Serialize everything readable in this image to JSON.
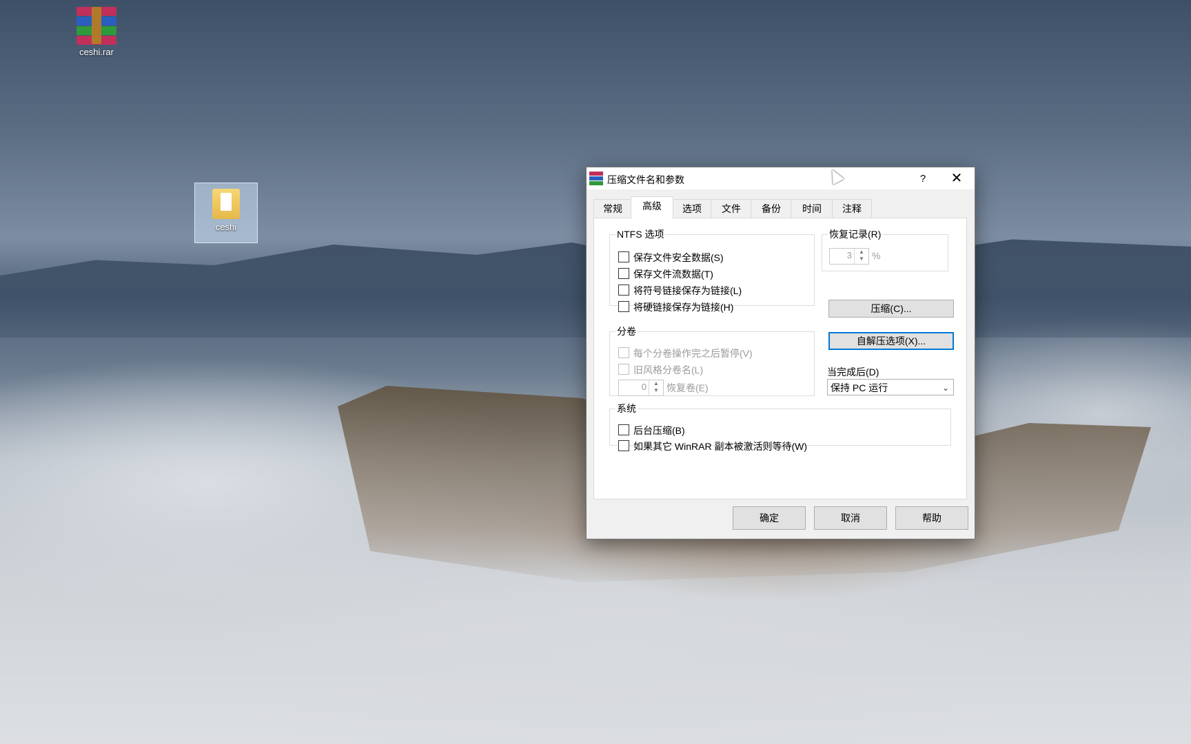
{
  "desktop": {
    "icons": [
      {
        "label": "ceshi.rar"
      },
      {
        "label": "ceshi"
      }
    ]
  },
  "dialog": {
    "title": "压缩文件名和参数",
    "help_glyph": "?",
    "close_glyph": "✕",
    "tabs": [
      {
        "label": "常规",
        "active": false
      },
      {
        "label": "高级",
        "active": true
      },
      {
        "label": "选项",
        "active": false
      },
      {
        "label": "文件",
        "active": false
      },
      {
        "label": "备份",
        "active": false
      },
      {
        "label": "时间",
        "active": false
      },
      {
        "label": "注释",
        "active": false
      }
    ],
    "ntfs": {
      "legend": "NTFS 选项",
      "options": [
        {
          "label": "保存文件安全数据(S)",
          "checked": false
        },
        {
          "label": "保存文件流数据(T)",
          "checked": false
        },
        {
          "label": "将符号链接保存为链接(L)",
          "checked": false
        },
        {
          "label": "将硬链接保存为链接(H)",
          "checked": false
        }
      ]
    },
    "volumes": {
      "legend": "分卷",
      "options": [
        {
          "label": "每个分卷操作完之后暂停(V)",
          "checked": false,
          "disabled": true
        },
        {
          "label": "旧风格分卷名(L)",
          "checked": false,
          "disabled": true
        }
      ],
      "recovery_volumes_value": "0",
      "recovery_volumes_label": "恢复卷(E)"
    },
    "recovery_record": {
      "legend": "恢复记录(R)",
      "value": "3",
      "unit": "%"
    },
    "buttons": {
      "compress": "压缩(C)...",
      "sfx_options": "自解压选项(X)..."
    },
    "after_completion": {
      "label": "当完成后(D)",
      "selected": "保持 PC 运行"
    },
    "system": {
      "legend": "系统",
      "options": [
        {
          "label": "后台压缩(B)",
          "checked": false
        },
        {
          "label": "如果其它 WinRAR 副本被激活则等待(W)",
          "checked": false
        }
      ]
    },
    "footer": {
      "ok": "确定",
      "cancel": "取消",
      "help": "帮助"
    }
  },
  "colors": {
    "focus_border": "#0078d7",
    "dialog_bg": "#f0f0f0"
  }
}
